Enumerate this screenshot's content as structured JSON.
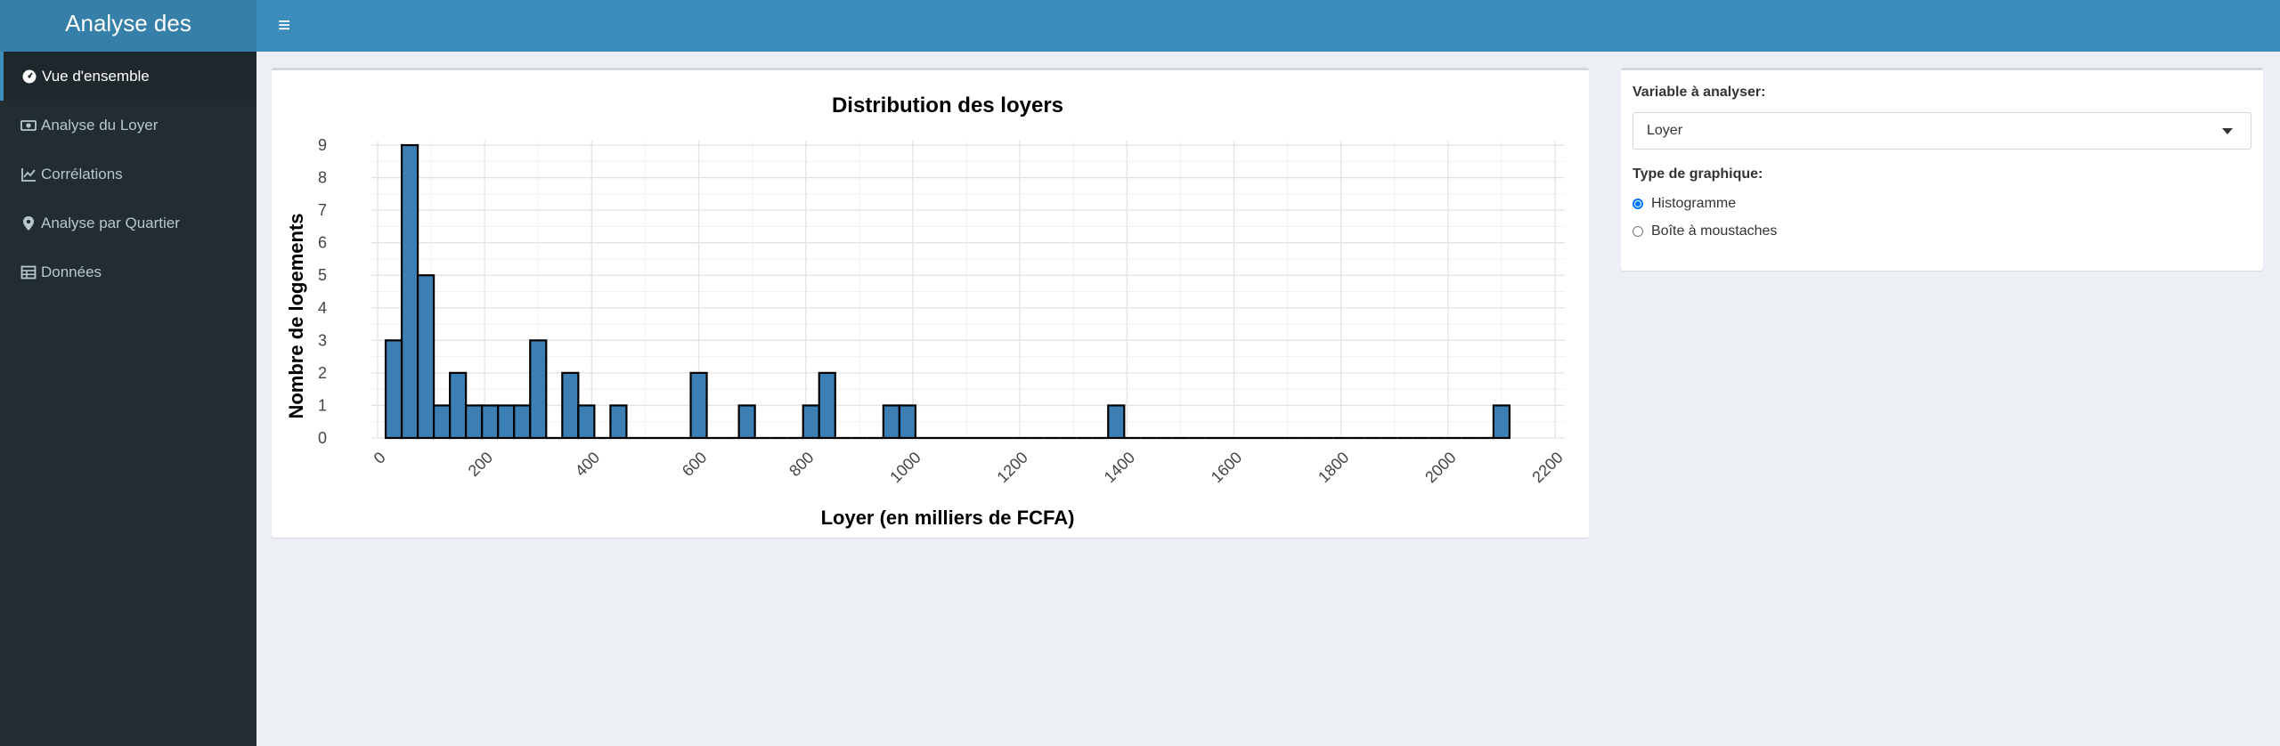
{
  "app": {
    "title": "Analyse des"
  },
  "sidebar": {
    "items": [
      {
        "label": "Vue d'ensemble",
        "icon": "dashboard-icon"
      },
      {
        "label": "Analyse du Loyer",
        "icon": "money-icon"
      },
      {
        "label": "Corrélations",
        "icon": "line-chart-icon"
      },
      {
        "label": "Analyse par Quartier",
        "icon": "map-marker-icon"
      },
      {
        "label": "Données",
        "icon": "table-icon"
      }
    ]
  },
  "controls": {
    "variable_label": "Variable à analyser:",
    "variable_value": "Loyer",
    "chart_type_label": "Type de graphique:",
    "options": [
      {
        "label": "Histogramme",
        "checked": true
      },
      {
        "label": "Boîte à moustaches",
        "checked": false
      }
    ]
  },
  "colors": {
    "accent": "#3c8dbc",
    "bar_fill": "#3c7fb5",
    "sidebar": "#222d32"
  },
  "chart_data": {
    "type": "bar",
    "title": "Distribution des loyers",
    "xlabel": "Loyer (en milliers de FCFA)",
    "ylabel": "Nombre de logements",
    "xlim": [
      0,
      2200
    ],
    "ylim": [
      0,
      9
    ],
    "xticks": [
      "0",
      "200",
      "400",
      "600",
      "800",
      "1000",
      "1200",
      "1400",
      "1600",
      "1800",
      "2000",
      "2200"
    ],
    "yticks": [
      "0",
      "1",
      "2",
      "3",
      "4",
      "5",
      "6",
      "7",
      "8",
      "9"
    ],
    "bin_width": 30,
    "bins": [
      {
        "start": 15,
        "count": 3
      },
      {
        "start": 45,
        "count": 9
      },
      {
        "start": 75,
        "count": 5
      },
      {
        "start": 105,
        "count": 1
      },
      {
        "start": 135,
        "count": 2
      },
      {
        "start": 165,
        "count": 1
      },
      {
        "start": 195,
        "count": 1
      },
      {
        "start": 225,
        "count": 1
      },
      {
        "start": 255,
        "count": 1
      },
      {
        "start": 285,
        "count": 3
      },
      {
        "start": 315,
        "count": 0
      },
      {
        "start": 345,
        "count": 2
      },
      {
        "start": 375,
        "count": 1
      },
      {
        "start": 405,
        "count": 0
      },
      {
        "start": 435,
        "count": 1
      },
      {
        "start": 465,
        "count": 0
      },
      {
        "start": 495,
        "count": 0
      },
      {
        "start": 525,
        "count": 0
      },
      {
        "start": 555,
        "count": 0
      },
      {
        "start": 585,
        "count": 2
      },
      {
        "start": 615,
        "count": 0
      },
      {
        "start": 645,
        "count": 0
      },
      {
        "start": 675,
        "count": 1
      },
      {
        "start": 705,
        "count": 0
      },
      {
        "start": 735,
        "count": 0
      },
      {
        "start": 765,
        "count": 0
      },
      {
        "start": 795,
        "count": 1
      },
      {
        "start": 825,
        "count": 2
      },
      {
        "start": 855,
        "count": 0
      },
      {
        "start": 885,
        "count": 0
      },
      {
        "start": 915,
        "count": 0
      },
      {
        "start": 945,
        "count": 1
      },
      {
        "start": 975,
        "count": 1
      },
      {
        "start": 1005,
        "count": 0
      },
      {
        "start": 1035,
        "count": 0
      },
      {
        "start": 1065,
        "count": 0
      },
      {
        "start": 1095,
        "count": 0
      },
      {
        "start": 1125,
        "count": 0
      },
      {
        "start": 1155,
        "count": 0
      },
      {
        "start": 1185,
        "count": 0
      },
      {
        "start": 1215,
        "count": 0
      },
      {
        "start": 1245,
        "count": 0
      },
      {
        "start": 1275,
        "count": 0
      },
      {
        "start": 1305,
        "count": 0
      },
      {
        "start": 1335,
        "count": 0
      },
      {
        "start": 1365,
        "count": 1
      },
      {
        "start": 1395,
        "count": 0
      },
      {
        "start": 1425,
        "count": 0
      },
      {
        "start": 1455,
        "count": 0
      },
      {
        "start": 1485,
        "count": 0
      },
      {
        "start": 1515,
        "count": 0
      },
      {
        "start": 1545,
        "count": 0
      },
      {
        "start": 1575,
        "count": 0
      },
      {
        "start": 1605,
        "count": 0
      },
      {
        "start": 1635,
        "count": 0
      },
      {
        "start": 1665,
        "count": 0
      },
      {
        "start": 1695,
        "count": 0
      },
      {
        "start": 1725,
        "count": 0
      },
      {
        "start": 1755,
        "count": 0
      },
      {
        "start": 1785,
        "count": 0
      },
      {
        "start": 1815,
        "count": 0
      },
      {
        "start": 1845,
        "count": 0
      },
      {
        "start": 1875,
        "count": 0
      },
      {
        "start": 1905,
        "count": 0
      },
      {
        "start": 1935,
        "count": 0
      },
      {
        "start": 1965,
        "count": 0
      },
      {
        "start": 1995,
        "count": 0
      },
      {
        "start": 2025,
        "count": 0
      },
      {
        "start": 2055,
        "count": 0
      },
      {
        "start": 2085,
        "count": 1
      }
    ],
    "grid": true,
    "legend": "none"
  }
}
